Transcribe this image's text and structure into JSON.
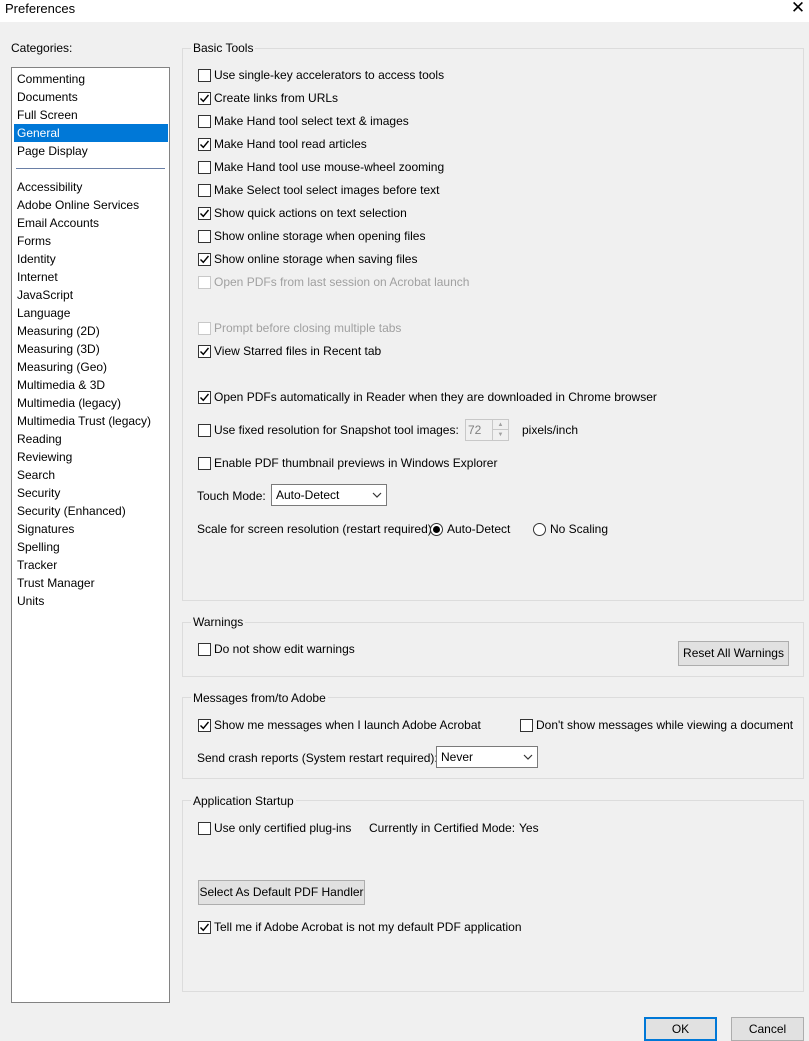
{
  "window": {
    "title": "Preferences",
    "close_glyph": "✕"
  },
  "categories": {
    "label": "Categories:",
    "top_items": [
      "Commenting",
      "Documents",
      "Full Screen",
      "General",
      "Page Display"
    ],
    "selected": "General",
    "items": [
      "Accessibility",
      "Adobe Online Services",
      "Email Accounts",
      "Forms",
      "Identity",
      "Internet",
      "JavaScript",
      "Language",
      "Measuring (2D)",
      "Measuring (3D)",
      "Measuring (Geo)",
      "Multimedia & 3D",
      "Multimedia (legacy)",
      "Multimedia Trust (legacy)",
      "Reading",
      "Reviewing",
      "Search",
      "Security",
      "Security (Enhanced)",
      "Signatures",
      "Spelling",
      "Tracker",
      "Trust Manager",
      "Units"
    ]
  },
  "basic_tools": {
    "title": "Basic Tools",
    "options": [
      {
        "label": "Use single-key accelerators to access tools",
        "checked": false,
        "disabled": false
      },
      {
        "label": "Create links from URLs",
        "checked": true,
        "disabled": false
      },
      {
        "label": "Make Hand tool select text & images",
        "checked": false,
        "disabled": false
      },
      {
        "label": "Make Hand tool read articles",
        "checked": true,
        "disabled": false
      },
      {
        "label": "Make Hand tool use mouse-wheel zooming",
        "checked": false,
        "disabled": false
      },
      {
        "label": "Make Select tool select images before text",
        "checked": false,
        "disabled": false
      },
      {
        "label": "Show quick actions on text selection",
        "checked": true,
        "disabled": false
      },
      {
        "label": "Show online storage when opening files",
        "checked": false,
        "disabled": false
      },
      {
        "label": "Show online storage when saving files",
        "checked": true,
        "disabled": false
      },
      {
        "label": "Open PDFs from last session on Acrobat launch",
        "checked": false,
        "disabled": true
      },
      {
        "label": "Prompt before closing multiple tabs",
        "checked": false,
        "disabled": true
      },
      {
        "label": "View Starred files in Recent tab",
        "checked": true,
        "disabled": false
      },
      {
        "label": "Open PDFs automatically in Reader when they are downloaded in Chrome browser",
        "checked": true,
        "disabled": false
      },
      {
        "label": "Use fixed resolution for Snapshot tool images:",
        "checked": false,
        "disabled": false
      },
      {
        "label": "Enable PDF thumbnail previews in Windows Explorer",
        "checked": false,
        "disabled": false
      }
    ],
    "snapshot_resolution": {
      "value": "72",
      "unit": "pixels/inch"
    },
    "touch_mode": {
      "label": "Touch Mode:",
      "value": "Auto-Detect"
    },
    "scale": {
      "label": "Scale for screen resolution (restart required):",
      "options": [
        {
          "label": "Auto-Detect",
          "selected": true
        },
        {
          "label": "No Scaling",
          "selected": false
        }
      ]
    }
  },
  "warnings": {
    "title": "Warnings",
    "option": {
      "label": "Do not show edit warnings",
      "checked": false
    },
    "reset_button": "Reset All Warnings"
  },
  "messages": {
    "title": "Messages from/to Adobe",
    "show_messages": {
      "label": "Show me messages when I launch Adobe Acrobat",
      "checked": true
    },
    "dont_show": {
      "label": "Don't show messages while viewing a document",
      "checked": false
    },
    "crash_label": "Send crash reports (System restart required):",
    "crash_value": "Never"
  },
  "startup": {
    "title": "Application Startup",
    "certified": {
      "label": "Use only certified plug-ins",
      "checked": false
    },
    "mode_label": "Currently in Certified Mode:",
    "mode_value": "Yes",
    "default_button": "Select As Default PDF Handler",
    "tell_me": {
      "label": "Tell me if Adobe Acrobat is not my default PDF application",
      "checked": true
    }
  },
  "footer": {
    "ok": "OK",
    "cancel": "Cancel"
  }
}
